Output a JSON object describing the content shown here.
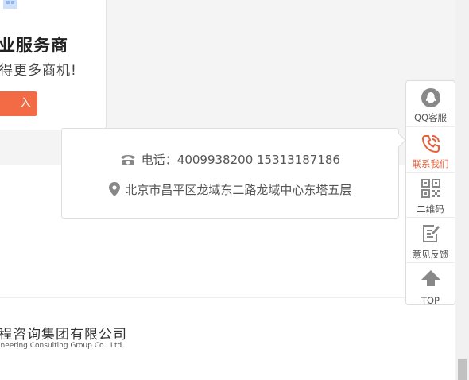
{
  "promo": {
    "title": "业服务商",
    "subtitle": "得更多商机!",
    "button_label": "入"
  },
  "contact": {
    "phone_text": "电话：4009938200 15313187186",
    "address_text": "北京市昌平区龙域东二路龙域中心东塔五层"
  },
  "footer": {
    "company_cn": "程咨询集团有限公司",
    "company_en": "ineering Consulting Group Co., Ltd."
  },
  "sidebar": {
    "items": [
      {
        "label": "QQ客服",
        "icon": "qq-icon"
      },
      {
        "label": "联系我们",
        "icon": "phone-icon",
        "active": true
      },
      {
        "label": "二维码",
        "icon": "qrcode-icon"
      },
      {
        "label": "意见反馈",
        "icon": "feedback-icon"
      },
      {
        "label": "TOP",
        "icon": "arrow-up-icon"
      }
    ]
  },
  "colors": {
    "accent": "#f26b45",
    "active_label": "#e85f3b",
    "icon_gray": "#888888",
    "band_gray": "#f4f4f4"
  }
}
